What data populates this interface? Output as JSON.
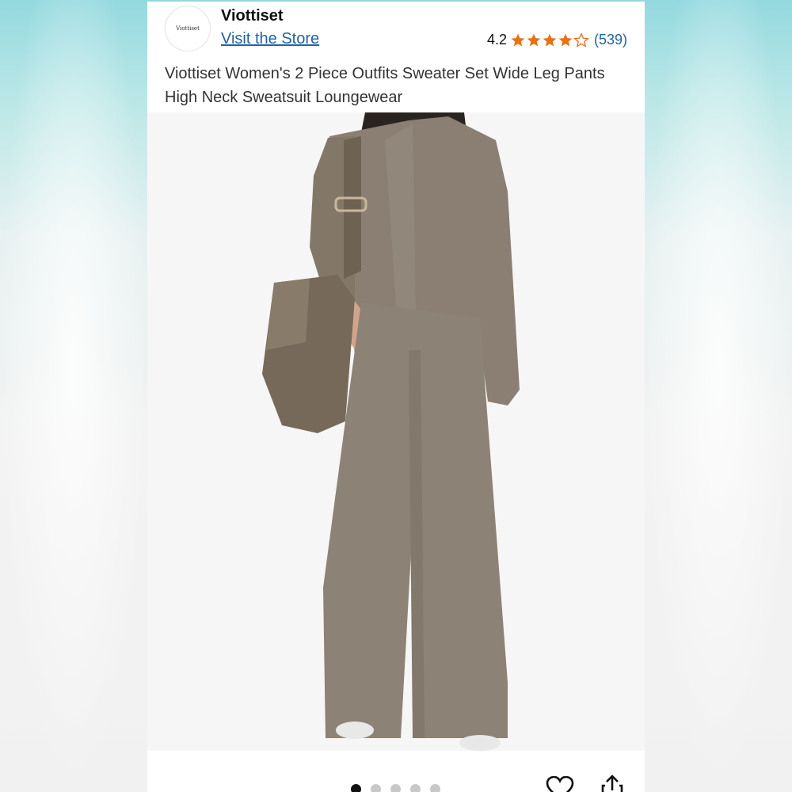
{
  "store": {
    "name": "Viottiset",
    "logo_text": "Viottiset",
    "link_label": "Visit the Store"
  },
  "rating": {
    "value": "4.2",
    "stars": 4.2,
    "count": "(539)",
    "star_color": "#e7711b"
  },
  "product": {
    "title": "Viottiset Women's 2 Piece Outfits Sweater Set Wide Leg Pants High Neck Sweatsuit Loungewear"
  },
  "gallery": {
    "total_images": 5,
    "active_index": 0
  },
  "actions": {
    "wishlist_icon": "heart-icon",
    "share_icon": "share-icon"
  }
}
